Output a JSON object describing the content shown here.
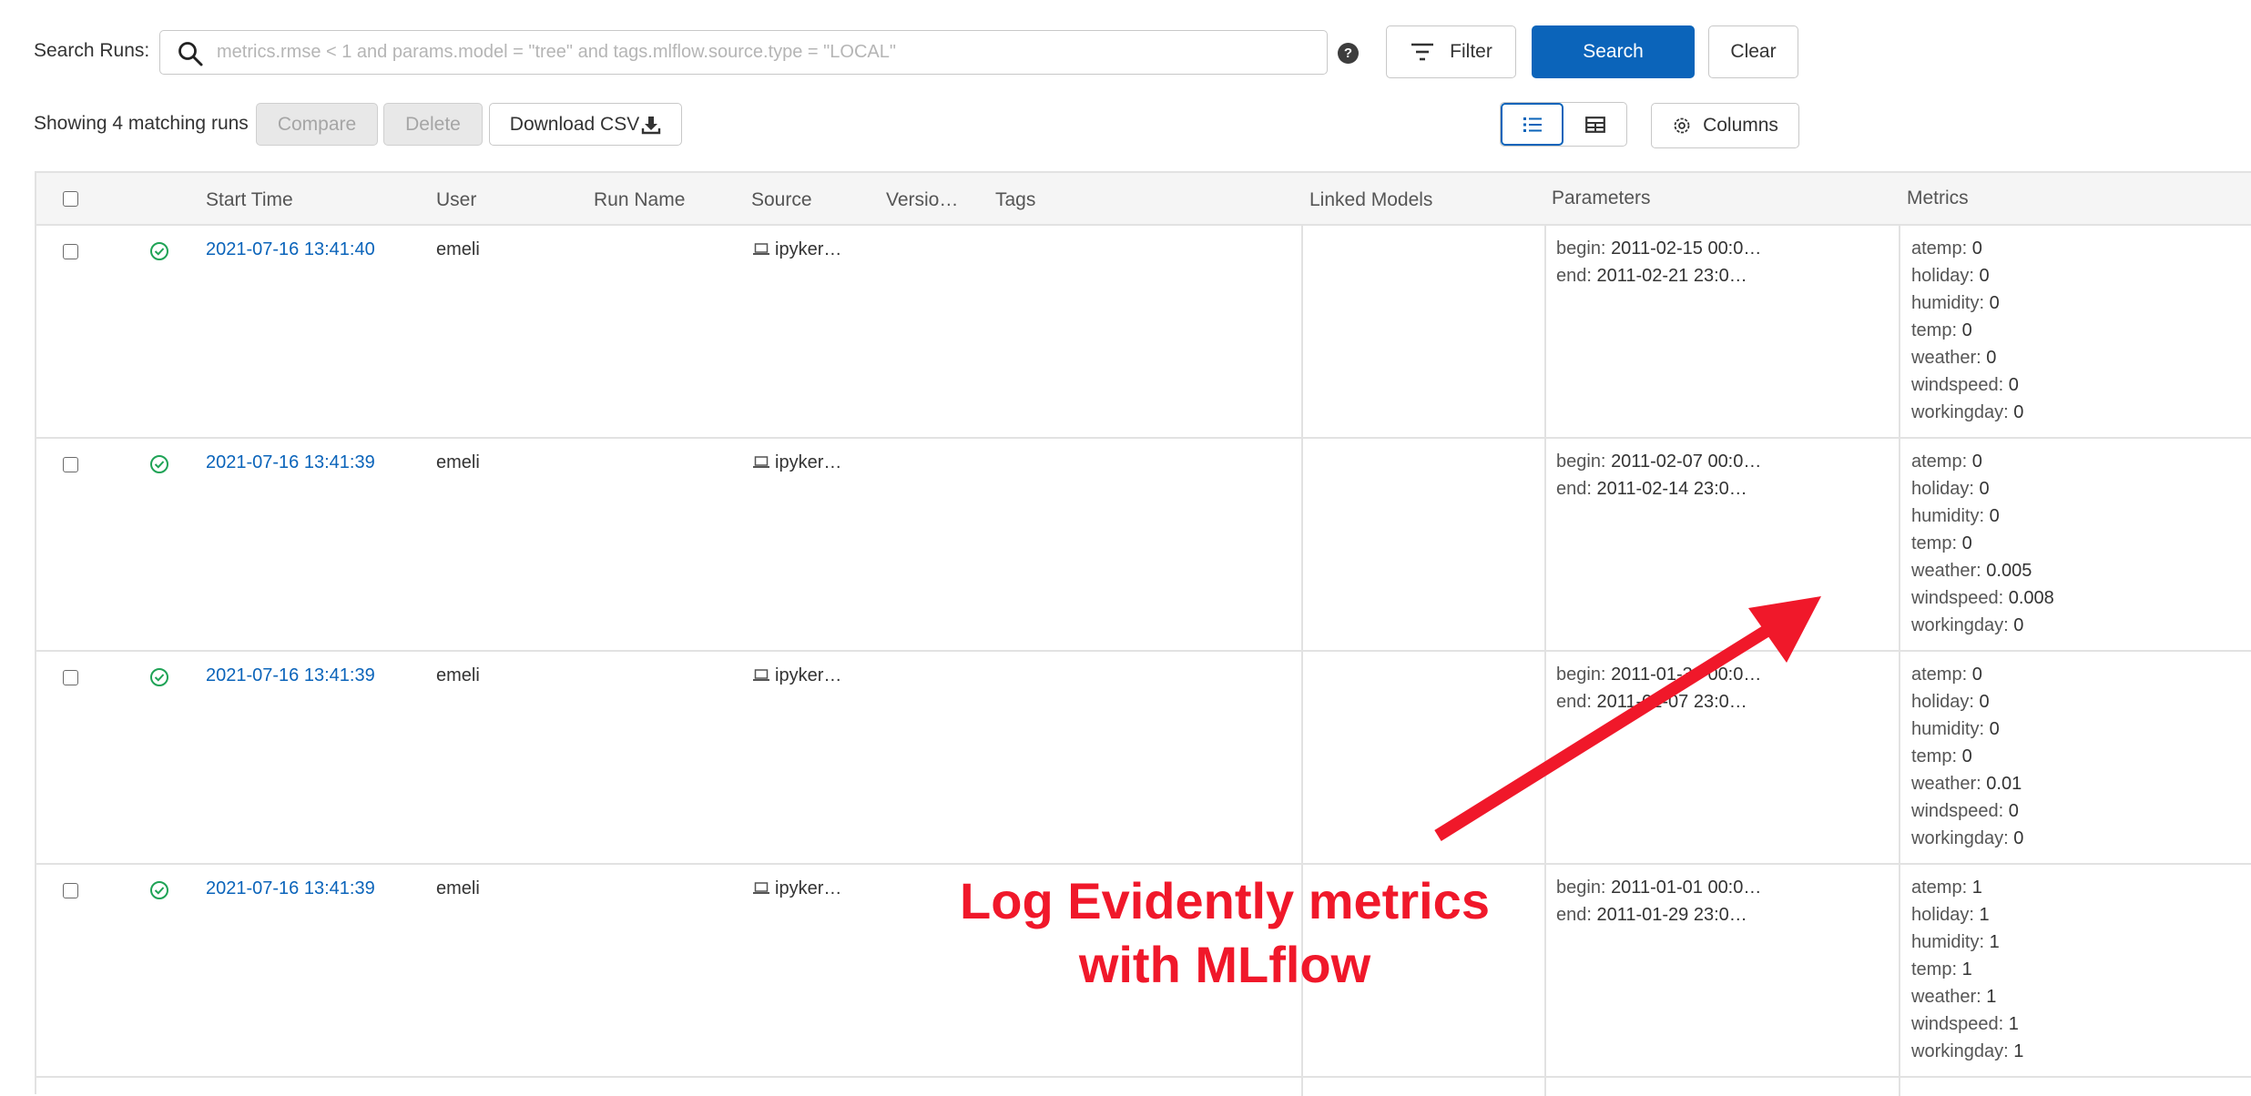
{
  "search": {
    "label": "Search Runs:",
    "placeholder": "metrics.rmse < 1 and params.model = \"tree\" and tags.mlflow.source.type = \"LOCAL\"",
    "help": "?"
  },
  "buttons": {
    "filter": "Filter",
    "search": "Search",
    "clear": "Clear",
    "compare": "Compare",
    "delete": "Delete",
    "download_csv": "Download CSV",
    "columns": "Columns"
  },
  "status": {
    "showing": "Showing 4 matching runs"
  },
  "table": {
    "headers": {
      "start_time": "Start Time",
      "user": "User",
      "run_name": "Run Name",
      "source": "Source",
      "version": "Versio…",
      "tags": "Tags",
      "linked_models": "Linked Models",
      "parameters": "Parameters",
      "metrics": "Metrics"
    },
    "rows": [
      {
        "start_time": "2021-07-16 13:41:40",
        "user": "emeli",
        "source": "ipyker…",
        "params": [
          [
            "begin: ",
            "2011-02-15 00:0…"
          ],
          [
            "end: ",
            "2011-02-21 23:0…"
          ]
        ],
        "metrics": [
          [
            "atemp: ",
            "0"
          ],
          [
            "holiday: ",
            "0"
          ],
          [
            "humidity: ",
            "0"
          ],
          [
            "temp: ",
            "0"
          ],
          [
            "weather: ",
            "0"
          ],
          [
            "windspeed: ",
            "0"
          ],
          [
            "workingday: ",
            "0"
          ]
        ]
      },
      {
        "start_time": "2021-07-16 13:41:39",
        "user": "emeli",
        "source": "ipyker…",
        "params": [
          [
            "begin: ",
            "2011-02-07 00:0…"
          ],
          [
            "end: ",
            "2011-02-14 23:0…"
          ]
        ],
        "metrics": [
          [
            "atemp: ",
            "0"
          ],
          [
            "holiday: ",
            "0"
          ],
          [
            "humidity: ",
            "0"
          ],
          [
            "temp: ",
            "0"
          ],
          [
            "weather: ",
            "0.005"
          ],
          [
            "windspeed: ",
            "0.008"
          ],
          [
            "workingday: ",
            "0"
          ]
        ]
      },
      {
        "start_time": "2021-07-16 13:41:39",
        "user": "emeli",
        "source": "ipyker…",
        "params": [
          [
            "begin: ",
            "2011-01-30 00:0…"
          ],
          [
            "end: ",
            "2011-02-07 23:0…"
          ]
        ],
        "metrics": [
          [
            "atemp: ",
            "0"
          ],
          [
            "holiday: ",
            "0"
          ],
          [
            "humidity: ",
            "0"
          ],
          [
            "temp: ",
            "0"
          ],
          [
            "weather: ",
            "0.01"
          ],
          [
            "windspeed: ",
            "0"
          ],
          [
            "workingday: ",
            "0"
          ]
        ]
      },
      {
        "start_time": "2021-07-16 13:41:39",
        "user": "emeli",
        "source": "ipyker…",
        "params": [
          [
            "begin: ",
            "2011-01-01 00:0…"
          ],
          [
            "end: ",
            "2011-01-29 23:0…"
          ]
        ],
        "metrics": [
          [
            "atemp: ",
            "1"
          ],
          [
            "holiday: ",
            "1"
          ],
          [
            "humidity: ",
            "1"
          ],
          [
            "temp: ",
            "1"
          ],
          [
            "weather: ",
            "1"
          ],
          [
            "windspeed: ",
            "1"
          ],
          [
            "workingday: ",
            "1"
          ]
        ]
      }
    ]
  },
  "annotation": {
    "line1": "Log Evidently metrics",
    "line2": "with MLflow",
    "color": "#f0182a"
  },
  "colors": {
    "primary": "#0b64ba",
    "success": "#1fa356",
    "annotation": "#f0182a"
  }
}
